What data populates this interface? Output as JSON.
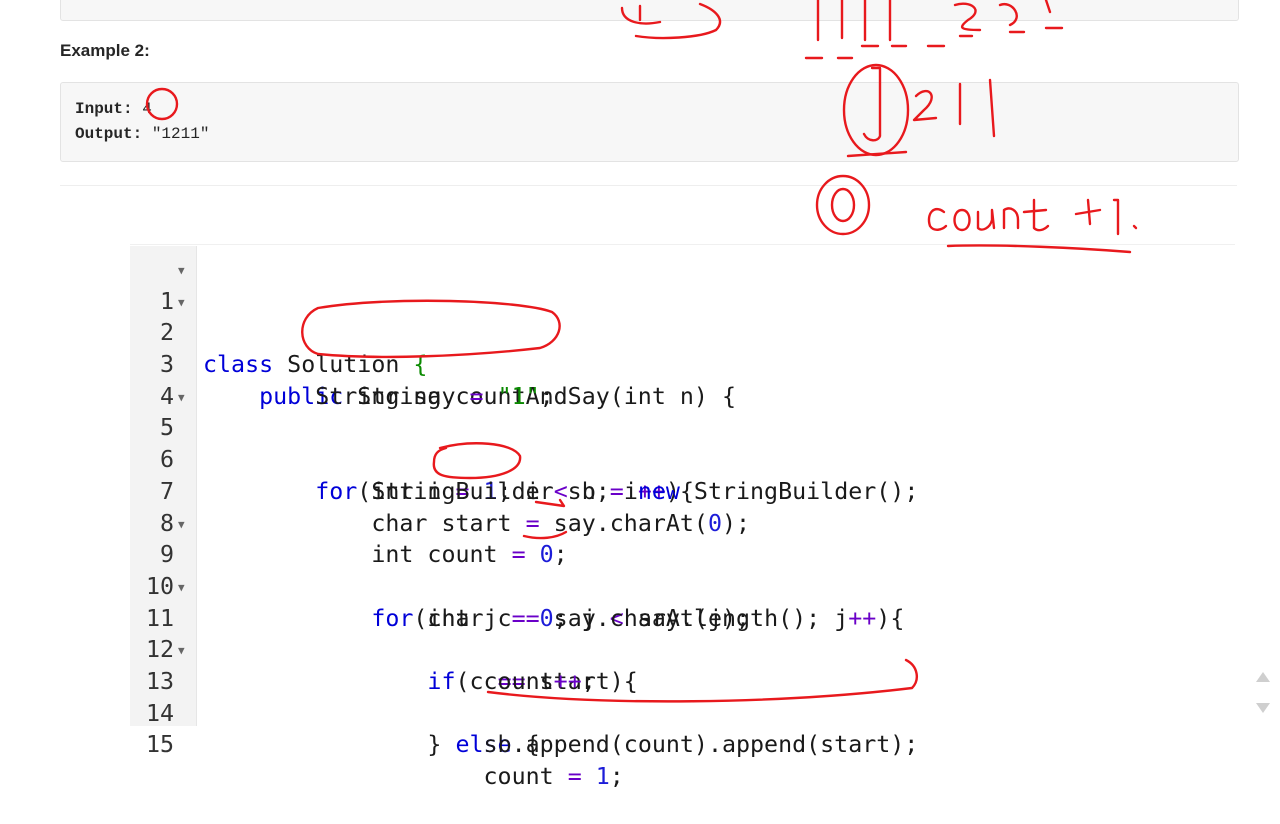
{
  "example": {
    "title": "Example 2:",
    "input_label": "Input:",
    "input_value": " 4",
    "output_label": "Output:",
    "output_value": " \"1211\""
  },
  "editor": {
    "lines": [
      {
        "n": "1",
        "fold": true
      },
      {
        "n": "2",
        "fold": true
      },
      {
        "n": "3",
        "fold": false
      },
      {
        "n": "4",
        "fold": false
      },
      {
        "n": "5",
        "fold": true
      },
      {
        "n": "6",
        "fold": false
      },
      {
        "n": "7",
        "fold": false
      },
      {
        "n": "8",
        "fold": false
      },
      {
        "n": "9",
        "fold": true
      },
      {
        "n": "10",
        "fold": false
      },
      {
        "n": "11",
        "fold": true
      },
      {
        "n": "12",
        "fold": false
      },
      {
        "n": "13",
        "fold": true
      },
      {
        "n": "14",
        "fold": false
      },
      {
        "n": "15",
        "fold": false
      }
    ],
    "tokens": {
      "l1_class": "class",
      "l1_rest": " Solution ",
      "l1_brace": "{",
      "l2_indent": "    ",
      "l2_public": "public",
      "l2_rest": " String countAndSay(int n) {",
      "l3_indent": "        ",
      "l3_a": "String say ",
      "l3_eq": "=",
      "l3_sp": " ",
      "l3_str": "\"1\"",
      "l3_end": ";",
      "l5_indent": "        ",
      "l5_for": "for",
      "l5_a": "(int i ",
      "l5_eq": "=",
      "l5_sp": " ",
      "l5_one": "1",
      "l5_b": "; i ",
      "l5_lt": "<",
      "l5_c": " n; i",
      "l5_pp": "++",
      "l5_d": "){",
      "l6_indent": "            ",
      "l6_a": "StringBuilder sb ",
      "l6_eq": "=",
      "l6_sp": " ",
      "l6_new": "new",
      "l6_b": " StringBuilder();",
      "l7_indent": "            ",
      "l7_a": "char start ",
      "l7_eq": "=",
      "l7_b": " say.charAt(",
      "l7_zero": "0",
      "l7_c": ");",
      "l8_indent": "            ",
      "l8_a": "int count ",
      "l8_eq": "=",
      "l8_sp": " ",
      "l8_zero": "0",
      "l8_b": ";",
      "l9_indent": "            ",
      "l9_for": "for",
      "l9_a": "(int j ",
      "l9_eq": "=",
      "l9_sp": " ",
      "l9_zero": "0",
      "l9_b": "; j ",
      "l9_lt": "<",
      "l9_c": " say.length(); j",
      "l9_pp": "++",
      "l9_d": "){",
      "l10_indent": "                ",
      "l10_a": "char c ",
      "l10_eq": "=",
      "l10_b": " say.charAt(j);",
      "l11_indent": "                ",
      "l11_if": "if",
      "l11_a": "(c ",
      "l11_eq": "==",
      "l11_b": " start){",
      "l12_indent": "                    ",
      "l12_a": "count",
      "l12_pp": "++",
      "l12_b": ";",
      "l13_indent": "                ",
      "l13_a": "} ",
      "l13_else": "else",
      "l13_b": " {",
      "l14_indent": "                    ",
      "l14_a": "sb.append(count).append(start);",
      "l15_indent": "                    ",
      "l15_a": "count ",
      "l15_eq": "=",
      "l15_sp": " ",
      "l15_one": "1",
      "l15_b": ";"
    }
  },
  "annotations": {
    "mark_zero": "0",
    "mark_count_plus_one": "count +1."
  },
  "colors": {
    "keyword": "#0000d8",
    "string": "#0a8a00",
    "number": "#1c1cd8",
    "operator": "#6a00c8",
    "ink": "#e8191d"
  }
}
